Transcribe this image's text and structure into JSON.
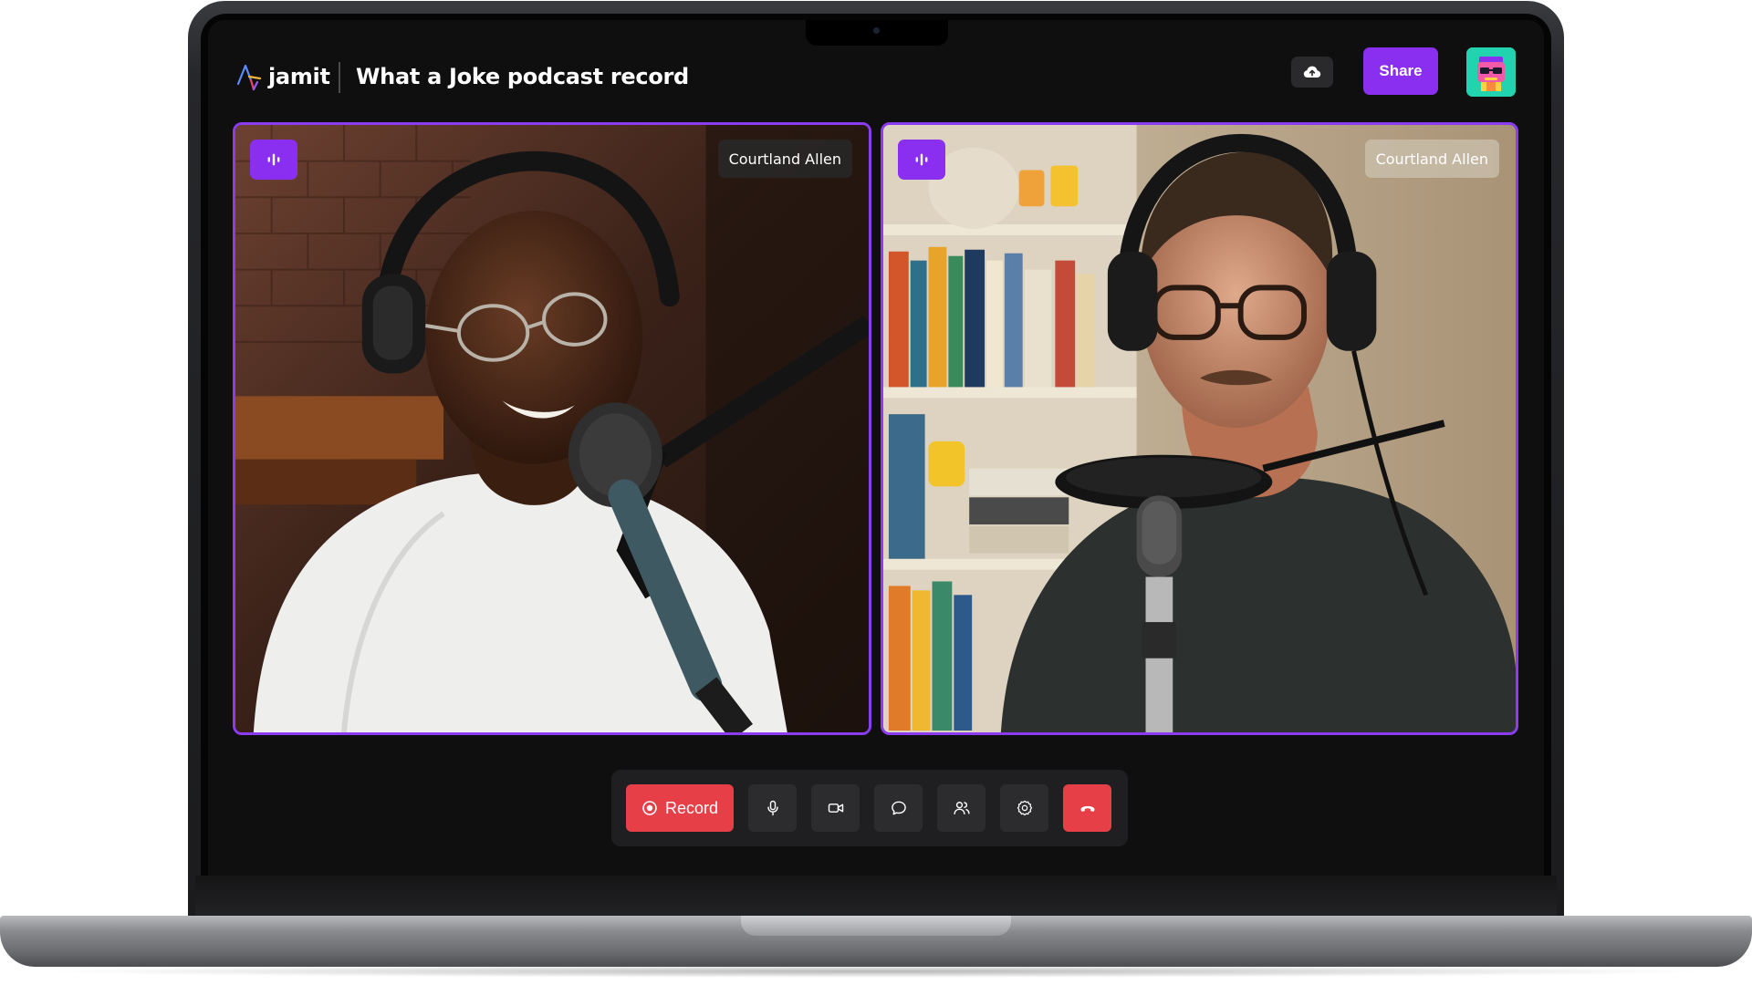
{
  "app": {
    "brand_name": "jamit",
    "session_title": "What a Joke podcast record"
  },
  "header": {
    "upload_icon": "cloud-upload-icon",
    "share_label": "Share",
    "avatar_icon": "user-avatar"
  },
  "participants": [
    {
      "name": "Courtland Allen",
      "speaking_icon": "audio-wave-icon"
    },
    {
      "name": "Courtland Allen",
      "speaking_icon": "audio-wave-icon"
    }
  ],
  "controls": {
    "record_label": "Record",
    "items": [
      {
        "icon": "microphone-icon"
      },
      {
        "icon": "video-camera-icon"
      },
      {
        "icon": "chat-bubble-icon"
      },
      {
        "icon": "participants-icon"
      },
      {
        "icon": "settings-gear-icon"
      },
      {
        "icon": "hang-up-icon"
      }
    ]
  },
  "colors": {
    "accent": "#8a2ff0",
    "danger": "#e63f48",
    "avatar_bg": "#22d3b0",
    "background": "#0f0f10"
  }
}
